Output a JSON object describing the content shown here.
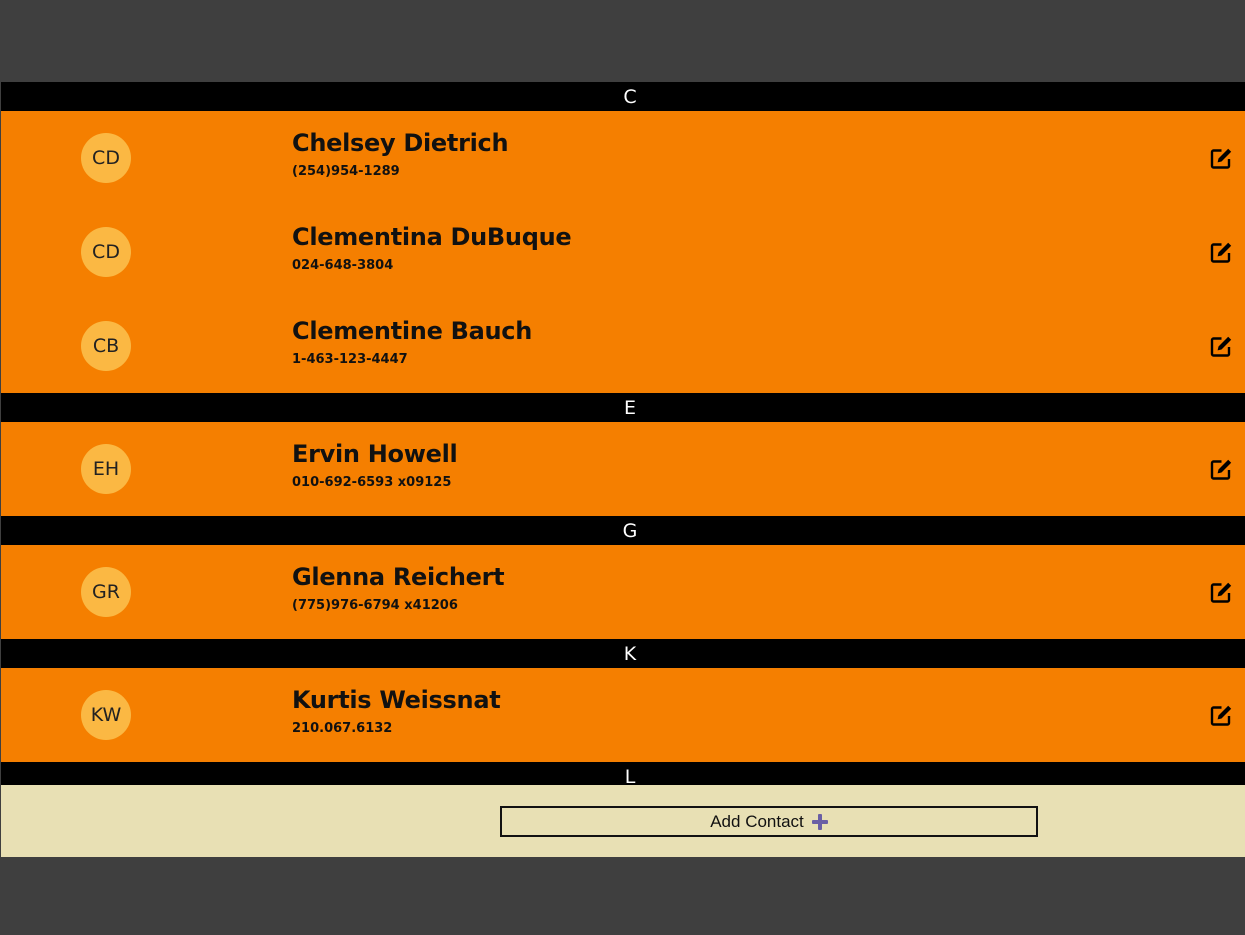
{
  "sections": [
    {
      "letter": "C",
      "contacts": [
        {
          "initials": "CD",
          "name": "Chelsey Dietrich",
          "phone": "(254)954-1289",
          "edit_icon": "edit-icon"
        },
        {
          "initials": "CD",
          "name": "Clementina DuBuque",
          "phone": "024-648-3804",
          "edit_icon": "edit-icon"
        },
        {
          "initials": "CB",
          "name": "Clementine Bauch",
          "phone": "1-463-123-4447",
          "edit_icon": "edit-icon"
        }
      ]
    },
    {
      "letter": "E",
      "contacts": [
        {
          "initials": "EH",
          "name": "Ervin Howell",
          "phone": "010-692-6593 x09125",
          "edit_icon": "edit-icon"
        }
      ]
    },
    {
      "letter": "G",
      "contacts": [
        {
          "initials": "GR",
          "name": "Glenna Reichert",
          "phone": "(775)976-6794 x41206",
          "edit_icon": "edit-icon"
        }
      ]
    },
    {
      "letter": "K",
      "contacts": [
        {
          "initials": "KW",
          "name": "Kurtis Weissnat",
          "phone": "210.067.6132",
          "edit_icon": "edit-icon"
        }
      ]
    },
    {
      "letter": "L",
      "contacts": []
    }
  ],
  "footer": {
    "add_contact_label": "Add Contact",
    "add_icon": "plus-icon"
  },
  "colors": {
    "page_background": "#3f3f3f",
    "section_header": "#000000",
    "row_background": "#f57f00",
    "avatar": "#fbb843",
    "footer_background": "#e8e0b4",
    "plus_icon": "#6a5fa5"
  }
}
